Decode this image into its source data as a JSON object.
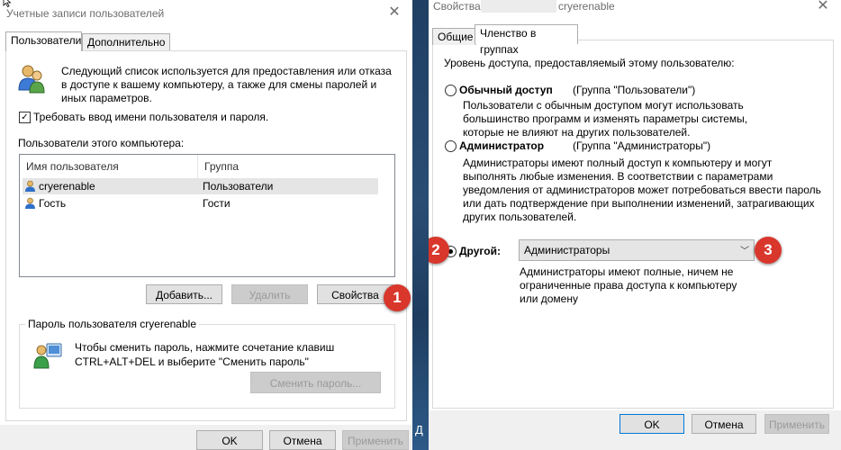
{
  "dialog1": {
    "title": "Учетные записи пользователей",
    "tabs": [
      {
        "label": "Пользователи",
        "active": true
      },
      {
        "label": "Дополнительно",
        "active": false
      }
    ],
    "intro_lines": [
      "Следующий список используется для предоставления или отказа",
      "в доступе к вашему компьютеру, а также для смены паролей и",
      "иных параметров."
    ],
    "require_password": {
      "label": "Требовать ввод имени пользователя и пароля.",
      "checked": true
    },
    "users_label": "Пользователи этого компьютера:",
    "table": {
      "columns": [
        "Имя пользователя",
        "Группа"
      ],
      "rows": [
        {
          "name": "cryerenable",
          "group": "Пользователи",
          "selected": true
        },
        {
          "name": "Гость",
          "group": "Гости",
          "selected": false
        }
      ]
    },
    "buttons": {
      "add": "Добавить...",
      "remove": "Удалить",
      "properties": "Свойства"
    },
    "password_group": {
      "legend": "Пароль пользователя cryerenable",
      "lines": [
        "Чтобы сменить пароль, нажмите сочетание клавиш",
        "CTRL+ALT+DEL и выберите \"Сменить пароль\""
      ],
      "change_button": "Сменить пароль..."
    },
    "footer": {
      "ok": "OK",
      "cancel": "Отмена",
      "apply": "Применить"
    }
  },
  "dialog2": {
    "title_prefix": "Свойства:",
    "title_suffix": "cryerenable",
    "tabs": [
      {
        "label": "Общие",
        "active": false
      },
      {
        "label": "Членство в группах",
        "active": true
      }
    ],
    "access_label": "Уровень доступа, предоставляемый этому пользователю:",
    "options": {
      "standard": {
        "label": "Обычный доступ",
        "group": "(Группа \"Пользователи\")",
        "checked": false,
        "desc": [
          "Пользователи с обычным доступом могут использовать",
          "большинство программ и изменять параметры системы,",
          "которые не влияют на других пользователей."
        ]
      },
      "admin": {
        "label": "Администратор",
        "group": "(Группа \"Администраторы\")",
        "checked": false,
        "desc": [
          "Администраторы имеют полный доступ к компьютеру и могут",
          "выполнять любые изменения. В соответствии с параметрами",
          "уведомления от администраторов может потребоваться ввести пароль",
          "или дать подтверждение при выполнении изменений, затрагивающих",
          "других пользователей."
        ]
      },
      "other": {
        "label": "Другой:",
        "checked": true,
        "selected_group": "Администраторы",
        "desc": [
          "Администраторы имеют полные, ничем не",
          "ограниченные права доступа к компьютеру",
          "или домену"
        ]
      }
    },
    "footer": {
      "ok": "OK",
      "cancel": "Отмена",
      "apply": "Применить"
    }
  },
  "markers": [
    "1",
    "2",
    "3"
  ],
  "desktop_glyph": "Д",
  "colors": {
    "marker": "#d9362c",
    "focus": "#0078d7",
    "selection": "#e5e5e5"
  }
}
